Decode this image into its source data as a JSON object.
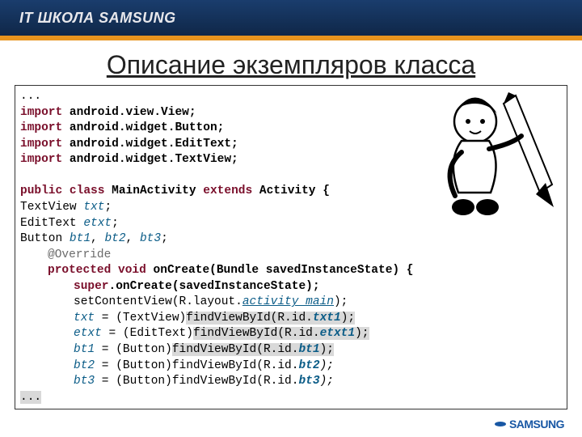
{
  "header": {
    "brand": "IT ШКОЛА SAMSUNG"
  },
  "title": "Описание экземпляров класса",
  "code": {
    "l0": "...",
    "kw_import": "import",
    "imp1": " android.view.View;",
    "imp2": " android.widget.Button;",
    "imp3": " android.widget.EditText;",
    "imp4": " android.widget.TextView;",
    "kw_public": "public",
    "kw_class": "class",
    "cls_name": " MainActivity ",
    "kw_extends": "extends",
    "cls_parent": " Activity {",
    "tv_decl": "TextView ",
    "txt": "txt",
    "semi": ";",
    "et_decl": "EditText ",
    "etxt": "etxt",
    "btn_decl": "Button ",
    "bt1": "bt1",
    "bt2": "bt2",
    "bt3": "bt3",
    "comma": ", ",
    "override": "@Override",
    "kw_protected": "protected",
    "kw_void": "void",
    "onCreate": " onCreate(Bundle savedInstanceState) {",
    "kw_super": "super",
    "super_rest": ".onCreate(savedInstanceState);",
    "setcv_a": "setContentView(R.layout.",
    "setcv_b": "activity_main",
    "setcv_c": ");",
    "a_txt_pre": " = (TextView)",
    "a_find1": "findViewById(R.id.",
    "a_txt1": "txt1",
    "a_close": ");",
    "a_etxt_pre": " = (EditText)",
    "a_etxt1": "etxt1",
    "a_btn_pre": " = (Button)",
    "dot": ".",
    "rfind": "findViewById(R",
    "dotid": "id",
    "l_end": "..."
  },
  "footer": {
    "logo": "SAMSUNG"
  }
}
